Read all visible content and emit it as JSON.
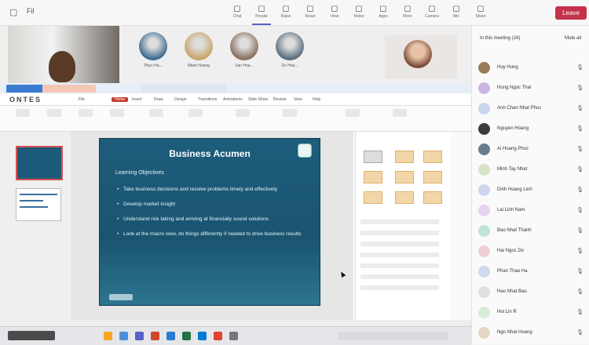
{
  "window": {
    "icon": "window-icon",
    "title": "Fil"
  },
  "toolbar": {
    "leave_label": "Leave",
    "buttons": [
      {
        "label": "Chat",
        "icon": "chat-icon"
      },
      {
        "label": "People",
        "icon": "people-icon"
      },
      {
        "label": "Raise",
        "icon": "hand-icon"
      },
      {
        "label": "React",
        "icon": "react-icon"
      },
      {
        "label": "View",
        "icon": "view-icon"
      },
      {
        "label": "Notes",
        "icon": "notes-icon"
      },
      {
        "label": "Apps",
        "icon": "apps-icon"
      },
      {
        "label": "More",
        "icon": "more-icon"
      },
      {
        "label": "Camera",
        "icon": "camera-icon"
      },
      {
        "label": "Mic",
        "icon": "mic-icon"
      },
      {
        "label": "Share",
        "icon": "share-icon"
      }
    ]
  },
  "video_strip": {
    "participants": [
      {
        "name": "Phuc Ha..."
      },
      {
        "name": "Nhan Hoang"
      },
      {
        "name": "Van Hoa..."
      },
      {
        "name": "Do Hoa..."
      }
    ]
  },
  "ppt": {
    "brand": "ONTES",
    "ribbon_tabs": [
      "File",
      "Home",
      "Insert",
      "Draw",
      "Design",
      "Transitions",
      "Animations",
      "Slide Show",
      "Review",
      "View",
      "Help"
    ],
    "slide": {
      "title": "Business Acumen",
      "subtitle": "Learning Objectives",
      "bullets": [
        "Take business decisions and resolve problems timely and effectively",
        "Develop market insight",
        "Understand risk taking and arriving at financially sound solutions",
        "Look at the macro view, do things differently if needed to drive business results"
      ]
    }
  },
  "sidebar": {
    "heading": "In this meeting (16)",
    "heading_action": "Mute all",
    "people": [
      {
        "name": "Huy Hung",
        "color": "#9a7b5c"
      },
      {
        "name": "Hung Ngoc Thai",
        "color": "#c9b6e4"
      },
      {
        "name": "Anh Chan Nhat Phuc",
        "color": "#c8d7ee"
      },
      {
        "name": "Nguyen Hoang",
        "color": "#3b3b3b"
      },
      {
        "name": "Ai Hoang Phuc",
        "color": "#6a7c8f"
      },
      {
        "name": "Minh Tay Nhat",
        "color": "#d6e3c7"
      },
      {
        "name": "Dinh Hoang Linh",
        "color": "#cfd6f0"
      },
      {
        "name": "Lai Linh Nam",
        "color": "#e7d3ef"
      },
      {
        "name": "Bao Nhat Thanh",
        "color": "#bfe4d4"
      },
      {
        "name": "Hai Ngoc Do",
        "color": "#f0cfd6"
      },
      {
        "name": "Phan Thao Ha",
        "color": "#cfd9f0"
      },
      {
        "name": "Hao Nhat Bao",
        "color": "#e0e0e0"
      },
      {
        "name": "Hoi Lin R",
        "color": "#d6ecd6"
      },
      {
        "name": "Ngo Nhat Hoang",
        "color": "#e6d6c6"
      }
    ]
  }
}
